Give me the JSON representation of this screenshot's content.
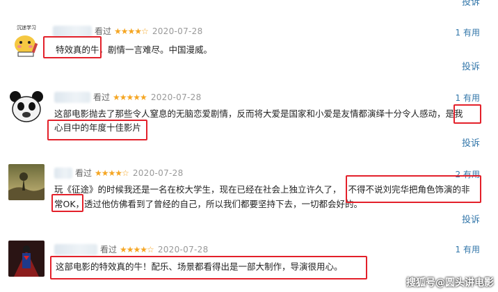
{
  "top": {
    "report_label": "投诉"
  },
  "reviews": [
    {
      "avatar_label": "沉迷学习",
      "action": "看过",
      "stars": "★★★★☆",
      "date": "2020-07-28",
      "useful": "1 有用",
      "report": "投诉",
      "line1_a": "特效真的牛",
      "line1_b": "，剧情一言难尽。中国漫威。"
    },
    {
      "action": "看过",
      "stars": "★★★★★",
      "date": "2020-07-28",
      "useful": "1 有用",
      "report": "投诉",
      "line1_a": "这部电影抛去了那些令人窒息的无脑恋爱剧情，反而将大爱是国家和小爱是友情都演绎十分令人感动，",
      "line1_b": "是我",
      "line2": "心目中的年度十佳影片"
    },
    {
      "action": "看过",
      "stars": "★★★★☆",
      "date": "2020-07-28",
      "useful": "2 有用",
      "report": "投诉",
      "line1_a": "玩《征途》的时候我还是一名在校大学生，现在已经在社会上独立许久了，",
      "line1_b": "不得不说刘完华把角色饰演的非",
      "line2_a": "常OK",
      "line2_b": "，透过他仿佛看到了曾经的自己，所以我们都要坚持下去，一切都会好的。"
    },
    {
      "action": "看过",
      "stars": "★★★★☆",
      "date": "2020-07-28",
      "useful": "1 有用",
      "line1": "这部电影的特效真的牛！配乐、场景都看得出是一部大制作，导演很用心。"
    }
  ],
  "watermark": "搜狐号@圆头讲电影",
  "colors": {
    "link": "#3377aa",
    "star": "#f5a623",
    "highlight": "#e3202a"
  }
}
